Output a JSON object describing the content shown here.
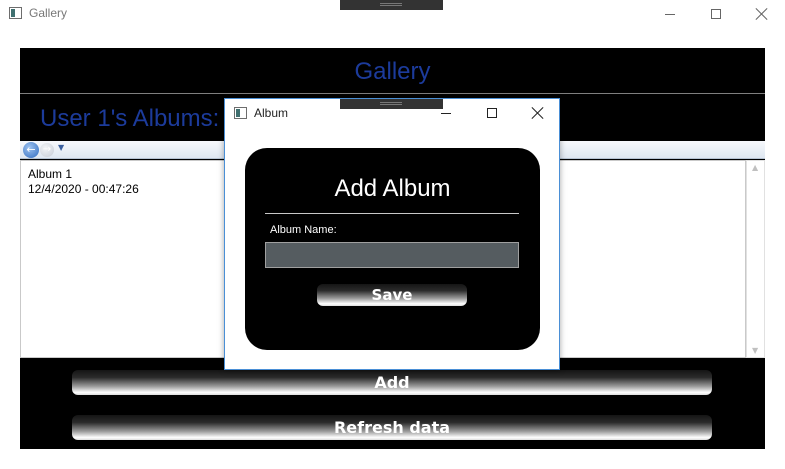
{
  "window": {
    "title": "Gallery",
    "header_title": "Gallery",
    "albums_heading": "User 1's Albums:"
  },
  "albums": [
    {
      "name": "Album 1",
      "date": "12/4/2020 - 00:47:26"
    }
  ],
  "buttons": {
    "add": "Add",
    "refresh": "Refresh data"
  },
  "dialog": {
    "title": "Album",
    "heading": "Add Album",
    "field_label": "Album Name:",
    "field_value": "",
    "save": "Save"
  },
  "icons": {
    "back": "back-arrow-icon",
    "forward": "forward-arrow-icon",
    "dropdown": "chevron-down-icon"
  }
}
